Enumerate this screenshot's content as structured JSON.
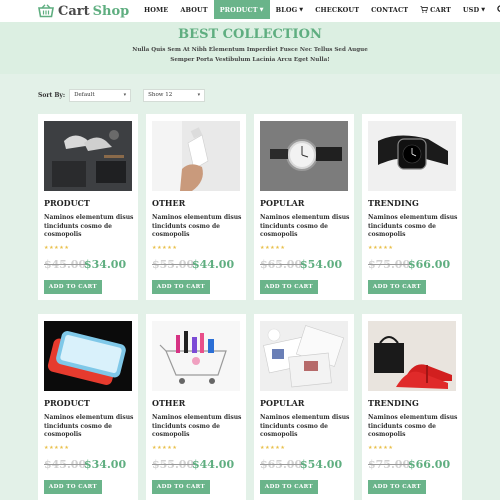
{
  "header": {
    "logo_cart": "Cart",
    "logo_shop": "Shop",
    "nav": [
      {
        "label": "HOME",
        "caret": false
      },
      {
        "label": "ABOUT",
        "caret": false
      },
      {
        "label": "PRODUCT",
        "caret": true
      },
      {
        "label": "BLOG",
        "caret": true
      },
      {
        "label": "CHECKOUT",
        "caret": false
      },
      {
        "label": "CONTACT",
        "caret": false
      }
    ],
    "cart_label": "CART",
    "currency_label": "USD",
    "accent": "#6ab48a"
  },
  "hero": {
    "title": "BEST COLLECTION",
    "subtitle": "Nulla Quis Sem At Nibh Elementum Imperdiet Fusce Nec Tellus Sed Augue Semper Porta Vestibulum Lacinia Arcu Eget Nulla!"
  },
  "filters": {
    "sort_label": "Sort By:",
    "sort_value": "Default",
    "show_value": "Show 12"
  },
  "products": [
    {
      "category": "PRODUCT",
      "desc": "Naminos elementum disus tincidunts cosmo de cosmopolis",
      "rating": 5,
      "old_price": "$45.00",
      "new_price": "$34.00",
      "button": "ADD TO CART",
      "image": "shoes-outfit"
    },
    {
      "category": "OTHER",
      "desc": "Naminos elementum disus tincidunts cosmo de cosmopolis",
      "rating": 5,
      "old_price": "$55.00",
      "new_price": "$44.00",
      "button": "ADD TO CART",
      "image": "bottle-hand"
    },
    {
      "category": "POPULAR",
      "desc": "Naminos elementum disus tincidunts cosmo de cosmopolis",
      "rating": 5,
      "old_price": "$65.00",
      "new_price": "$54.00",
      "button": "ADD TO CART",
      "image": "wristwatch"
    },
    {
      "category": "TRENDING",
      "desc": "Naminos elementum disus tincidunts cosmo de cosmopolis",
      "rating": 5,
      "old_price": "$75.00",
      "new_price": "$66.00",
      "button": "ADD TO CART",
      "image": "smartwatch"
    },
    {
      "category": "PRODUCT",
      "desc": "Naminos elementum disus tincidunts cosmo de cosmopolis",
      "rating": 5,
      "old_price": "$45.00",
      "new_price": "$34.00",
      "button": "ADD TO CART",
      "image": "smartphone"
    },
    {
      "category": "OTHER",
      "desc": "Naminos elementum disus tincidunts cosmo de cosmopolis",
      "rating": 5,
      "old_price": "$55.00",
      "new_price": "$44.00",
      "button": "ADD TO CART",
      "image": "cosmetics-cart"
    },
    {
      "category": "POPULAR",
      "desc": "Naminos elementum disus tincidunts cosmo de cosmopolis",
      "rating": 5,
      "old_price": "$65.00",
      "new_price": "$54.00",
      "button": "ADD TO CART",
      "image": "magazines"
    },
    {
      "category": "TRENDING",
      "desc": "Naminos elementum disus tincidunts cosmo de cosmopolis",
      "rating": 5,
      "old_price": "$75.00",
      "new_price": "$66.00",
      "button": "ADD TO CART",
      "image": "heels-bag"
    }
  ]
}
